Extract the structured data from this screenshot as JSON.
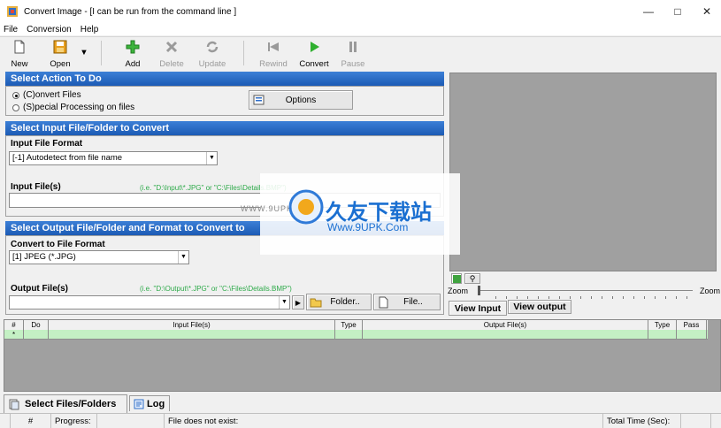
{
  "window": {
    "title": "Convert Image - [I can be run from the command line ]"
  },
  "menu": [
    "File",
    "Conversion",
    "Help"
  ],
  "toolbar": {
    "new": "New",
    "open": "Open",
    "add": "Add",
    "delete": "Delete",
    "update": "Update",
    "rewind": "Rewind",
    "convert": "Convert",
    "pause": "Pause"
  },
  "action": {
    "header": "Select Action To Do",
    "opt_convert": "(C)onvert Files",
    "opt_special": "(S)pecial Processing on files",
    "options_btn": "Options"
  },
  "input": {
    "header": "Select Input File/Folder to Convert",
    "format_label": "Input File Format",
    "format_value": "[-1] Autodetect from file name",
    "files_label": "Input File(s)",
    "files_hint": "(i.e. \"D:\\Input\\*.JPG\" or \"C:\\Files\\Details.BMP\")"
  },
  "output": {
    "header": "Select Output File/Folder and Format to Convert to",
    "format_label": "Convert to File Format",
    "format_value": "[1] JPEG (*.JPG)",
    "files_label": "Output File(s)",
    "files_hint": "(i.e. \"D:\\Output\\*.JPG\" or \"C:\\Files\\Details.BMP\")",
    "folder_btn": "Folder..",
    "file_btn": "File.."
  },
  "preview": {
    "zoom_label": "Zoom",
    "zoom_label_right": "Zoom",
    "view_input": "View Input",
    "view_output": "View output"
  },
  "grid": {
    "columns": [
      "#",
      "Do",
      "Input File(s)",
      "Type",
      "Output File(s)",
      "Type",
      "Pass"
    ],
    "row_marker": "*"
  },
  "tabs": {
    "select": "Select Files/Folders",
    "log": "Log"
  },
  "status": {
    "num": "#",
    "progress": "Progress:",
    "file_status": "File does not exist:",
    "total_time": "Total Time (Sec):"
  },
  "watermark": {
    "url": "WWW.9UPK.COM",
    "brand": "久友下载站",
    "brand_url": "Www.9UPK.Com"
  },
  "colors": {
    "section_header": "#1c5bb5",
    "grid_row": "#c4f0c4",
    "hint": "#2eaa4a",
    "preview_bg": "#a0a0a0"
  }
}
